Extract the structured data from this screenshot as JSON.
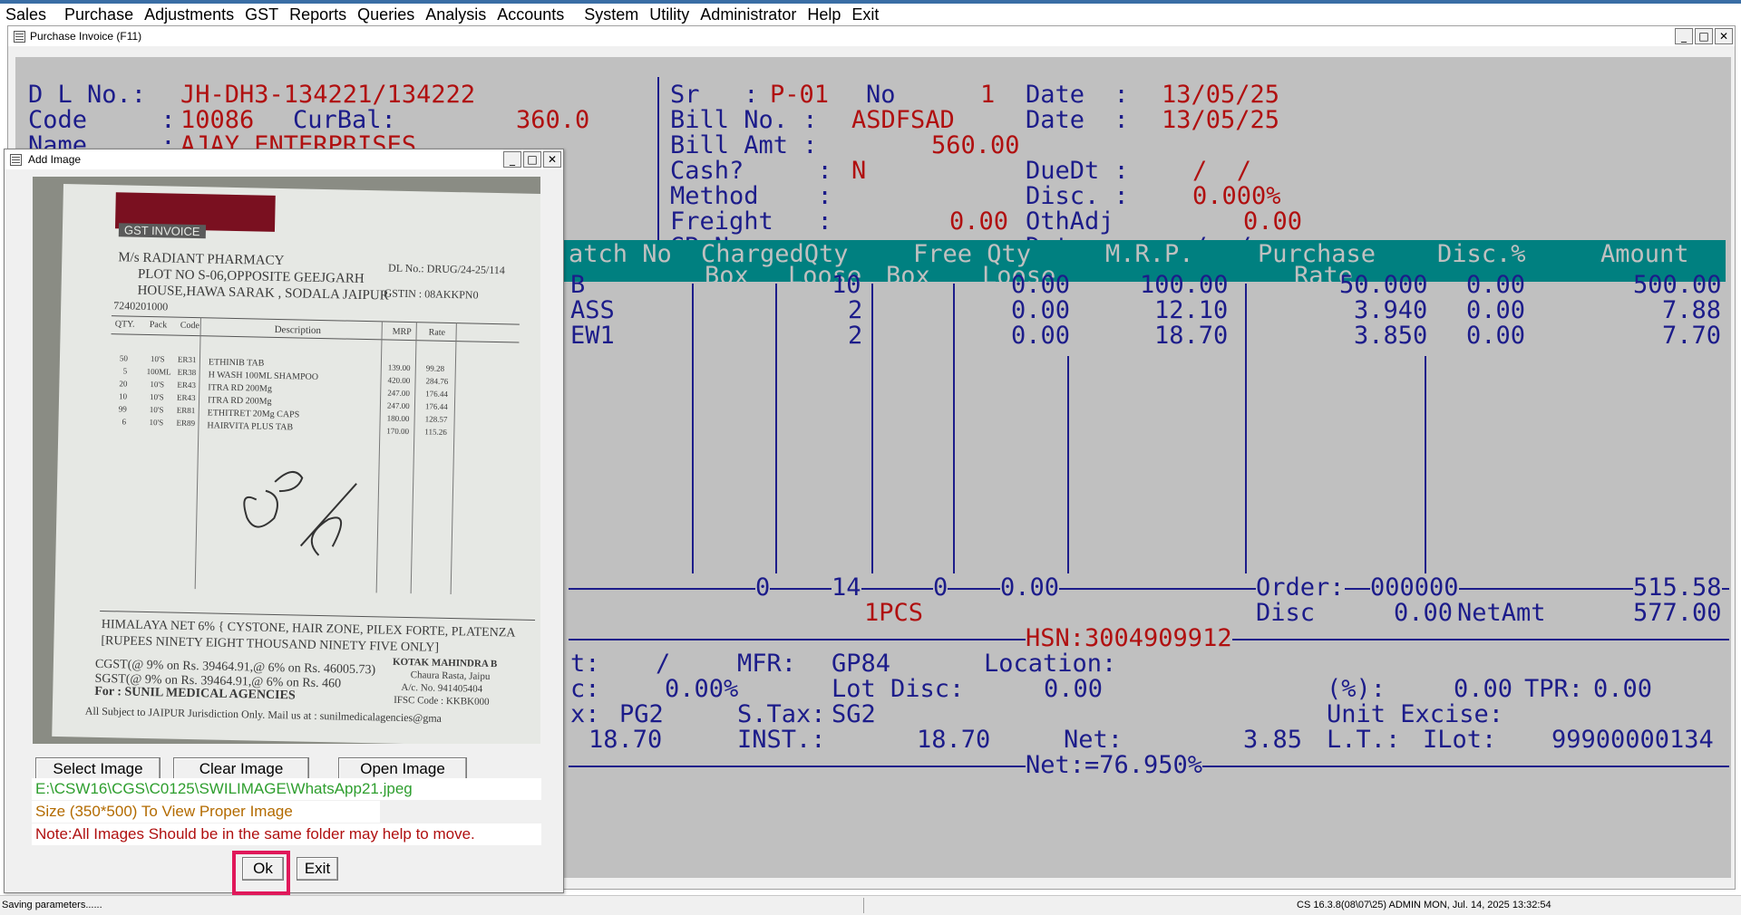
{
  "menu": [
    "Sales",
    "Purchase",
    "Adjustments",
    "GST",
    "Reports",
    "Queries",
    "Analysis",
    "Accounts",
    "System",
    "Utility",
    "Administrator",
    "Help",
    "Exit"
  ],
  "child_window": {
    "title": "Purchase Invoice  (F11)"
  },
  "invoice": {
    "dl_no_label": "D L No.:",
    "dl_no": "JH-DH3-134221/134222",
    "code_label": "Code     :",
    "code": "10086",
    "curbal_label": "CurBal:",
    "curbal": "360.0",
    "name_label": "Name     :",
    "name": "AJAY ENTERPRISES",
    "sr_label": "Sr   :",
    "sr": "P-01",
    "no_label": "No",
    "no": "1",
    "date_label": "Date  :",
    "date": "13/05/25",
    "bill_no_label": "Bill No. :",
    "bill_no": "ASDFSAD",
    "bill_date_label": "Date  :",
    "bill_date": "13/05/25",
    "bill_amt_label": "Bill Amt :",
    "bill_amt": "560.00",
    "cash_label": "Cash?     :",
    "cash": "N",
    "duedt_label": "DueDt :",
    "duedt": "/  /",
    "method_label": "Method    :",
    "disc_label": "Disc. :",
    "disc": "0.000%",
    "freight_label": "Freight   :",
    "freight": "0.00",
    "othadj_label": "OthAdj",
    "othadj": "0.00",
    "grno_label": "GR No.    :",
    "gr_date_label": "Date  :",
    "gr_date": "/  /"
  },
  "grid": {
    "header1": [
      "atch No",
      "ChargedQty",
      "Free Qty",
      "M.R.P.",
      "Purchase",
      "Disc.%",
      "Amount"
    ],
    "header2": [
      "Box",
      "Loose",
      "Box",
      "Loose",
      "Rate"
    ],
    "rows": [
      {
        "item": "B",
        "loose": "10",
        "free_loose": "0.00",
        "mrp": "100.00",
        "rate": "50.000",
        "disc": "0.00",
        "amount": "500.00"
      },
      {
        "item": "ASS",
        "loose": "2",
        "free_loose": "0.00",
        "mrp": "12.10",
        "rate": "3.940",
        "disc": "0.00",
        "amount": "7.88"
      },
      {
        "item": "EW1",
        "loose": "2",
        "free_loose": "0.00",
        "mrp": "18.70",
        "rate": "3.850",
        "disc": "0.00",
        "amount": "7.70"
      }
    ],
    "totals": {
      "box": "0",
      "loose": "14",
      "free_box": "0",
      "free_loose": "0.00",
      "order_label": "Order:",
      "order": "000000",
      "total": "515.58"
    },
    "pcs": "1PCS",
    "disc_label": "Disc",
    "disc_val": "0.00",
    "netamt_label": "NetAmt",
    "netamt": "577.00",
    "hsn": "HSN:3004909912"
  },
  "footer": {
    "r1": {
      "a": "t:",
      "b": "/",
      "mfr_label": "MFR:",
      "mfr": "GP84",
      "loc_label": "Location:"
    },
    "r2": {
      "a": "c:",
      "b": "0.00%",
      "lotdisc_label": "Lot Disc:",
      "lotdisc": "0.00",
      "pct_label": "(%):",
      "pct": "0.00",
      "tpr_label": "TPR:",
      "tpr": "0.00"
    },
    "r3": {
      "a": "x:",
      "b": "PG2",
      "stax_label": "S.Tax:",
      "stax": "SG2",
      "unitex_label": "Unit Excise:"
    },
    "r4": {
      "a": "18.70",
      "inst_label": "INST.:",
      "inst": "18.70",
      "net_label": "Net:",
      "net": "3.85",
      "lt_label": "L.T.:",
      "ilot_label": "ILot:",
      "ilot": "99900000134"
    },
    "net_pct": "Net:=76.950%"
  },
  "dialog": {
    "title": "Add Image",
    "select_label": "Select Image",
    "clear_label": "Clear Image",
    "open_label": "Open Image",
    "path": "E:\\CSW16\\CGS\\C0125\\SWILIMAGE\\WhatsApp21.jpeg",
    "size_note": "Size (350*500) To View Proper Image",
    "folder_note": "Note:All Images Should be in the same folder may help to move.",
    "ok_label": "Ok",
    "exit_label": "Exit",
    "colors": {
      "path": "#2e9e2e",
      "size": "#b36b00",
      "note": "#b01010"
    }
  },
  "invoice_image": {
    "header": "GST INVOICE",
    "firm": "M/s  RADIANT PHARMACY",
    "addr1": "PLOT NO S-06,OPPOSITE GEEJGARH",
    "addr2": "HOUSE,HAWA SARAK , SODALA JAIPUR",
    "phone": "7240201000",
    "dl": "DL No.: DRUG/24-25/114",
    "gstin": "GSTIN :     08AKKPN0",
    "cols": [
      "QTY.",
      "Pack",
      "Code",
      "Description",
      "MRP",
      "Rate"
    ],
    "lines": [
      {
        "q": "50",
        "p": "10'S",
        "c": "ER31",
        "d": "ETHINIB TAB",
        "m": "139.00",
        "r": "99.28"
      },
      {
        "q": "5",
        "p": "100ML",
        "c": "ER38",
        "d": "H WASH 100ML SHAMPOO",
        "m": "420.00",
        "r": "284.76"
      },
      {
        "q": "20",
        "p": "10'S",
        "c": "ER43",
        "d": "ITRA RD 200Mg",
        "m": "247.00",
        "r": "176.44"
      },
      {
        "q": "10",
        "p": "10'S",
        "c": "ER43",
        "d": "ITRA RD 200Mg",
        "m": "247.00",
        "r": "176.44"
      },
      {
        "q": "99",
        "p": "10'S",
        "c": "ER81",
        "d": "ETHITRET 20Mg CAPS",
        "m": "180.00",
        "r": "128.57"
      },
      {
        "q": "6",
        "p": "10'S",
        "c": "ER89",
        "d": "HAIRVITA PLUS TAB",
        "m": "170.00",
        "r": "115.26"
      }
    ],
    "note1": "HIMALAYA NET 6% { CYSTONE, HAIR ZONE, PILEX FORTE, PLATENZA",
    "note2": "[RUPEES  NINETY EIGHT THOUSAND NINETY FIVE ONLY]",
    "cgst": "CGST(@ 9% on Rs. 39464.91,@ 6% on Rs. 46005.73)",
    "sgst": "SGST(@ 9% on Rs. 39464.91,@ 6% on Rs. 460",
    "for": "For : SUNIL MEDICAL AGENCIES",
    "bank": "KOTAK MAHINDRA B",
    "bank2": "Chaura Rasta, Jaipu",
    "acno": "A/c. No. 941405404",
    "ifsc": "IFSC Code : KKBK000",
    "juris": "All Subject to JAIPUR Jurisdiction Only.   Mail us at : sunilmedicalagencies@gma"
  },
  "status": {
    "left": "Saving parameters......",
    "right": "CS 16.3.8(08\\07\\25) ADMIN   MON, Jul. 14, 2025  13:32:54"
  }
}
